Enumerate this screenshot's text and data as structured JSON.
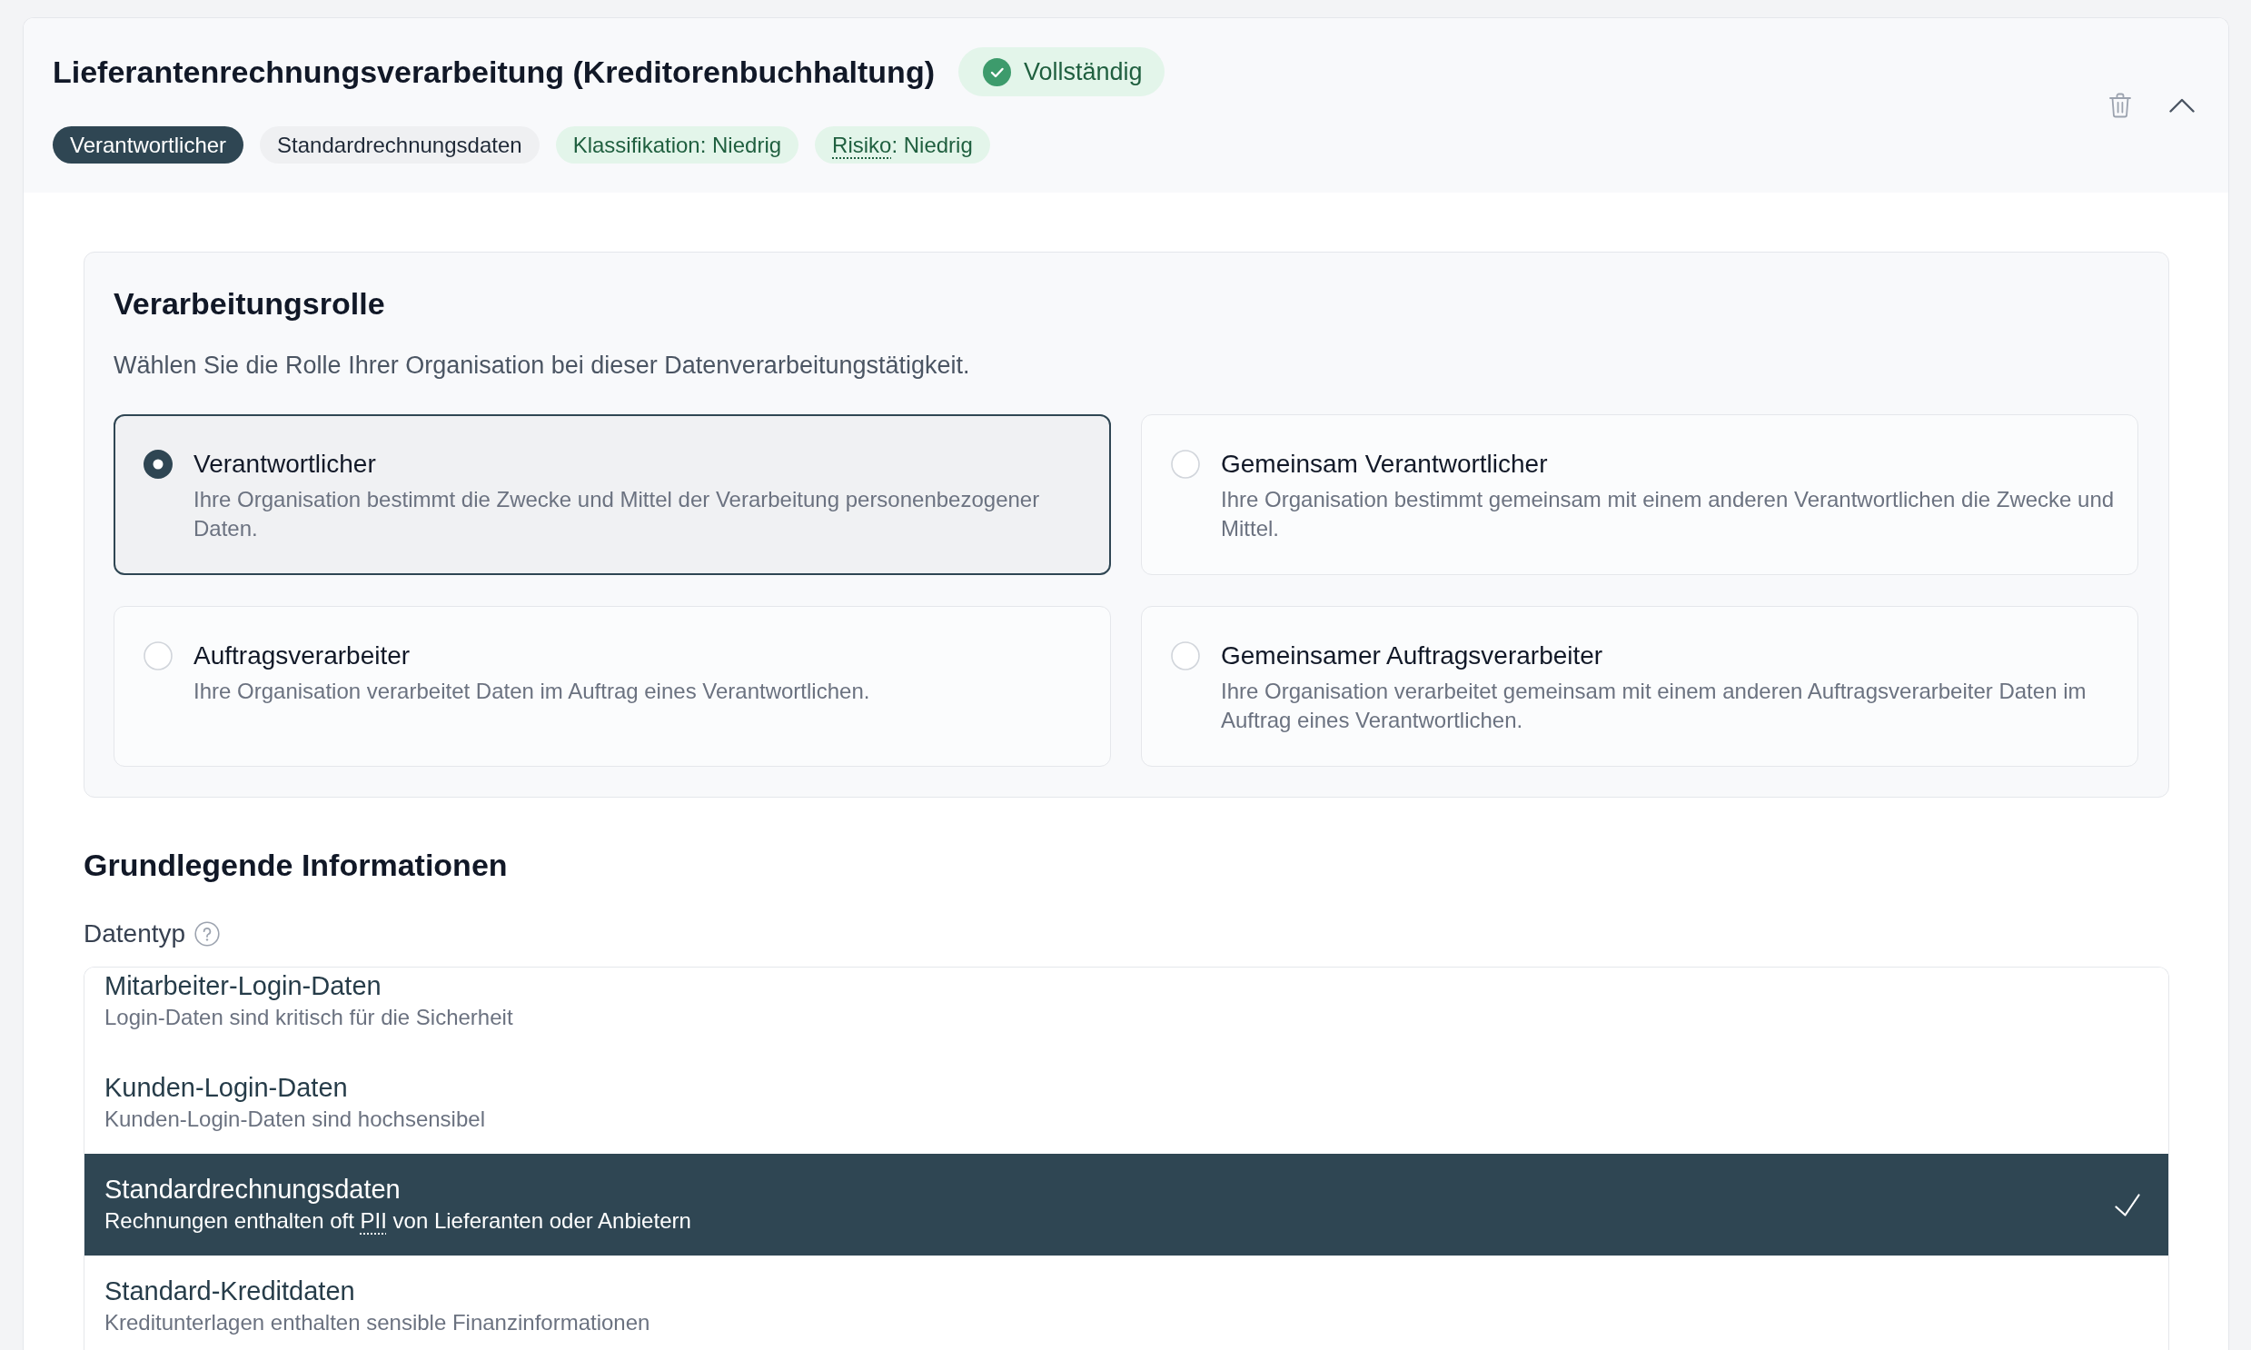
{
  "header": {
    "title": "Lieferantenrechnungsverarbeitung (Kreditorenbuchhaltung)",
    "status": {
      "kind": "complete",
      "label": "Vollständig"
    },
    "expanded": true,
    "tags": [
      {
        "kind": "role",
        "label": "Verantwortlicher"
      },
      {
        "kind": "data_type",
        "label": "Standardrechnungsdaten"
      },
      {
        "kind": "classification",
        "label": "Klassifikation: Niedrig"
      },
      {
        "kind": "risk",
        "label": [
          {
            "text": "Risiko",
            "dotted": true
          },
          {
            "text": ": Niedrig",
            "dotted": false
          }
        ]
      }
    ]
  },
  "role_section": {
    "title": "Verarbeitungsrolle",
    "description": "Wählen Sie die Rolle Ihrer Organisation bei dieser Datenverarbeitungstätigkeit.",
    "options": [
      {
        "title": "Verantwortlicher",
        "description": "Ihre Organisation bestimmt die Zwecke und Mittel der Verarbeitung personenbezogener Daten.",
        "selected": true
      },
      {
        "title": "Gemeinsam Verantwortlicher",
        "description": "Ihre Organisation bestimmt gemeinsam mit einem anderen Verantwortlichen die Zwecke und Mittel.",
        "selected": false
      },
      {
        "title": "Auftragsverarbeiter",
        "description": "Ihre Organisation verarbeitet Daten im Auftrag eines Verantwortlichen.",
        "selected": false
      },
      {
        "title": "Gemeinsamer Auftragsverarbeiter",
        "description": "Ihre Organisation verarbeitet gemeinsam mit einem anderen Auftragsverarbeiter Daten im Auftrag eines Verantwortlichen.",
        "selected": false
      }
    ]
  },
  "basic_info": {
    "title": "Grundlegende Informationen",
    "data_type": {
      "label": "Datentyp",
      "options": [
        {
          "title": "Mitarbeiter-Login-Daten",
          "description": "Login-Daten sind kritisch für die Sicherheit",
          "selected": false
        },
        {
          "title": "Kunden-Login-Daten",
          "description": "Kunden-Login-Daten sind hochsensibel",
          "selected": false
        },
        {
          "title": "Standardrechnungsdaten",
          "description": [
            {
              "text": "Rechnungen enthalten oft ",
              "dotted": false
            },
            {
              "text": "PII",
              "dotted": true
            },
            {
              "text": " von Lieferanten oder Anbietern",
              "dotted": false
            }
          ],
          "selected": true
        },
        {
          "title": "Standard-Kreditdaten",
          "description": "Kreditunterlagen enthalten sensible Finanzinformationen",
          "selected": false
        }
      ]
    }
  }
}
